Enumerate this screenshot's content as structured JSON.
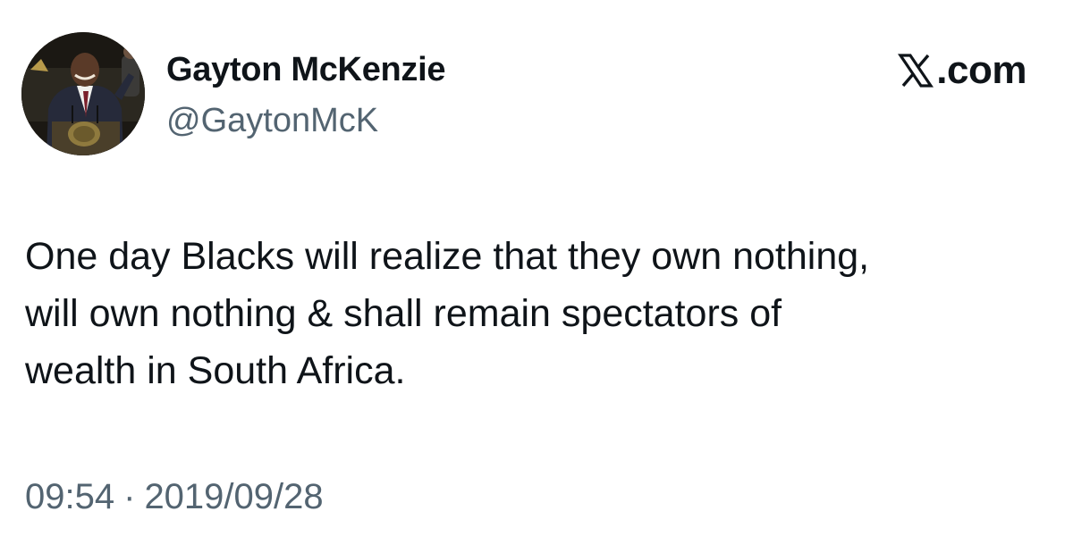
{
  "author": {
    "display_name": "Gayton McKenzie",
    "handle": "@GaytonMcK"
  },
  "brand": {
    "domain_text": ".com",
    "icon": "x-logo-icon"
  },
  "tweet": {
    "text_lines": [
      "One day Blacks will realize that they own nothing,",
      "will own nothing & shall remain spectators of",
      "wealth in South Africa."
    ],
    "time": "09:54",
    "separator": "·",
    "date": "2019/09/28"
  },
  "colors": {
    "primary_text": "#0f1419",
    "secondary_text": "#536471",
    "background": "#ffffff"
  }
}
